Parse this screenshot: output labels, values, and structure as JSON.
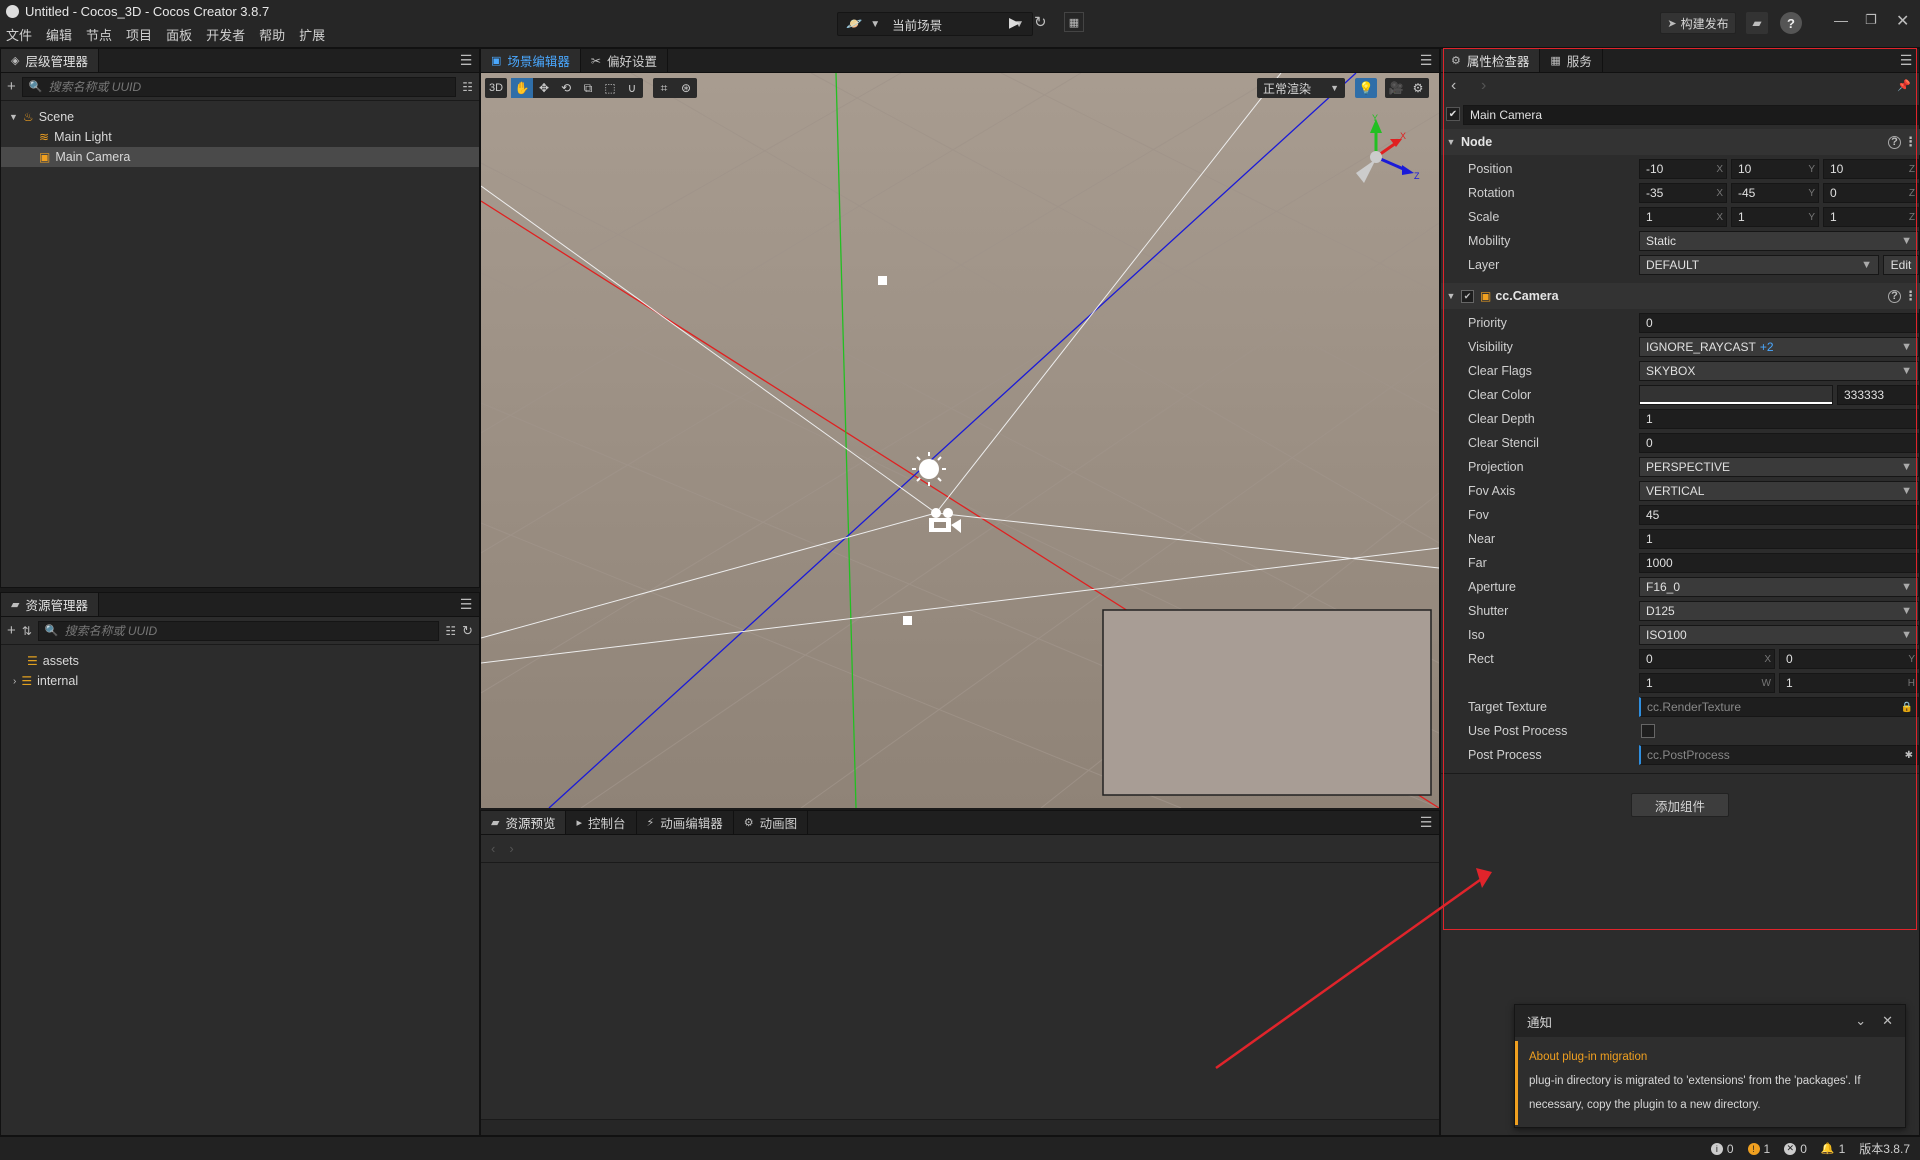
{
  "window": {
    "title": "Untitled - Cocos_3D - Cocos Creator 3.8.7"
  },
  "menu": [
    "文件",
    "编辑",
    "节点",
    "项目",
    "面板",
    "开发者",
    "帮助",
    "扩展"
  ],
  "toolbar": {
    "scene_select": "当前场景",
    "build_label": "构建发布"
  },
  "hierarchy": {
    "tab": "层级管理器",
    "search_placeholder": "搜索名称或 UUID",
    "items": [
      "Scene",
      "Main Light",
      "Main Camera"
    ]
  },
  "assets": {
    "tab": "资源管理器",
    "search_placeholder": "搜索名称或 UUID",
    "items": [
      "assets",
      "internal"
    ]
  },
  "scene": {
    "tabs": [
      "场景编辑器",
      "偏好设置"
    ],
    "mode_3d": "3D",
    "render_mode": "正常渲染",
    "gizmo": {
      "x": "X",
      "y": "Y",
      "z": "Z"
    }
  },
  "bottom": {
    "tabs": [
      "资源预览",
      "控制台",
      "动画编辑器",
      "动画图"
    ]
  },
  "inspector": {
    "tabs": [
      "属性检查器",
      "服务"
    ],
    "node_name": "Main Camera",
    "node_section": "Node",
    "position": {
      "label": "Position",
      "x": "-10",
      "y": "10",
      "z": "10"
    },
    "rotation": {
      "label": "Rotation",
      "x": "-35",
      "y": "-45",
      "z": "0"
    },
    "scale": {
      "label": "Scale",
      "x": "1",
      "y": "1",
      "z": "1"
    },
    "mobility": {
      "label": "Mobility",
      "value": "Static"
    },
    "layer": {
      "label": "Layer",
      "value": "DEFAULT",
      "edit": "Edit"
    },
    "camera_section": "cc.Camera",
    "priority": {
      "label": "Priority",
      "value": "0"
    },
    "visibility": {
      "label": "Visibility",
      "value": "IGNORE_RAYCAST",
      "extra": "+2"
    },
    "clear_flags": {
      "label": "Clear Flags",
      "value": "SKYBOX"
    },
    "clear_color": {
      "label": "Clear Color",
      "value": "333333"
    },
    "clear_depth": {
      "label": "Clear Depth",
      "value": "1"
    },
    "clear_stencil": {
      "label": "Clear Stencil",
      "value": "0"
    },
    "projection": {
      "label": "Projection",
      "value": "PERSPECTIVE"
    },
    "fov_axis": {
      "label": "Fov Axis",
      "value": "VERTICAL"
    },
    "fov": {
      "label": "Fov",
      "value": "45"
    },
    "near": {
      "label": "Near",
      "value": "1"
    },
    "far": {
      "label": "Far",
      "value": "1000"
    },
    "aperture": {
      "label": "Aperture",
      "value": "F16_0"
    },
    "shutter": {
      "label": "Shutter",
      "value": "D125"
    },
    "iso": {
      "label": "Iso",
      "value": "ISO100"
    },
    "rect": {
      "label": "Rect",
      "x": "0",
      "y": "0",
      "w": "1",
      "h": "1"
    },
    "target_texture": {
      "label": "Target Texture",
      "value": "cc.RenderTexture"
    },
    "use_post_process": {
      "label": "Use Post Process"
    },
    "post_process": {
      "label": "Post Process",
      "value": "cc.PostProcess"
    },
    "add_component": "添加组件"
  },
  "notification": {
    "title": "通知",
    "heading": "About plug-in migration",
    "body": "plug-in directory is migrated to 'extensions' from the 'packages'. If necessary, copy the plugin to a new directory."
  },
  "statusbar": {
    "info": "0",
    "warn": "1",
    "error": "0",
    "bell": "1",
    "version": "版本3.8.7"
  },
  "colors": {
    "highlight": "#e0242b",
    "accent": "#2f8fe0",
    "warn": "#f0a020"
  }
}
